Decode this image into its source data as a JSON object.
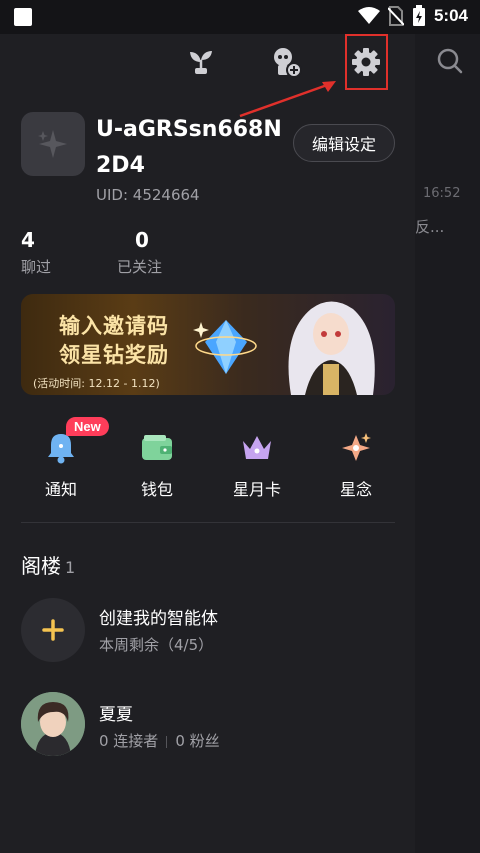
{
  "status_bar": {
    "time": "5:04"
  },
  "background_page": {
    "time": "16:52",
    "snippet": "反..."
  },
  "profile": {
    "username": "U-aGRSsn668N2D4",
    "uid": "UID: 4524664",
    "edit_label": "编辑设定"
  },
  "stats": [
    {
      "value": "4",
      "label": "聊过"
    },
    {
      "value": "0",
      "label": "已关注"
    }
  ],
  "banner": {
    "line1": "输入邀请码",
    "line2": "领星钻奖励",
    "period": "(活动时间: 12.12 - 1.12)"
  },
  "quick_actions": [
    {
      "label": "通知",
      "icon": "bell-icon",
      "badge": "New"
    },
    {
      "label": "钱包",
      "icon": "wallet-icon"
    },
    {
      "label": "星月卡",
      "icon": "crown-icon"
    },
    {
      "label": "星念",
      "icon": "sparkle-icon"
    }
  ],
  "section": {
    "title": "阁楼",
    "count": "1"
  },
  "create_agent": {
    "title": "创建我的智能体",
    "subtitle": "本周剩余（4/5）"
  },
  "agent": {
    "name": "夏夏",
    "connectors": "0 连接者",
    "fans": "0 粉丝"
  },
  "colors": {
    "highlight": "#e0302b",
    "badge": "#ff3d5a",
    "plus": "#f5c451"
  }
}
